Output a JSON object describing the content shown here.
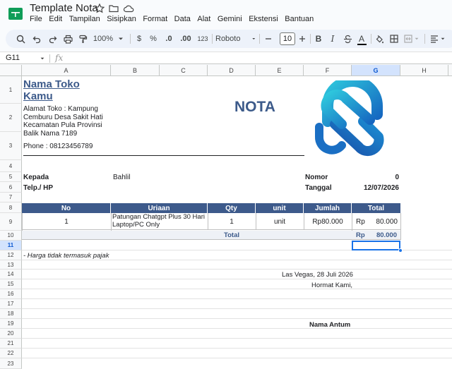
{
  "app": {
    "doc_title": "Template Nota",
    "menus": [
      "File",
      "Edit",
      "Tampilan",
      "Sisipkan",
      "Format",
      "Data",
      "Alat",
      "Gemini",
      "Ekstensi",
      "Bantuan"
    ]
  },
  "toolbar": {
    "zoom": "100%",
    "currency": "$",
    "percent": "%",
    "dec_decrease": ".0",
    "dec_increase": ".00",
    "number_format": "123",
    "font": "Roboto",
    "font_size": "10",
    "bold": "B",
    "italic": "I",
    "text_color_label": "A"
  },
  "formula_bar": {
    "cell_ref": "G11",
    "fx": "fx"
  },
  "columns": [
    "A",
    "B",
    "C",
    "D",
    "E",
    "F",
    "G",
    "H"
  ],
  "rows": [
    "1",
    "2",
    "3",
    "4",
    "5",
    "6",
    "7",
    "8",
    "9",
    "10",
    "11",
    "12",
    "13",
    "14",
    "15",
    "16",
    "17",
    "18",
    "19",
    "20",
    "21",
    "22",
    "23"
  ],
  "selected": {
    "col": "G",
    "row": "11"
  },
  "invoice": {
    "store_name_1": "Nama Toko",
    "store_name_2": "Kamu",
    "address_lines": [
      "Alamat Toko : Kampung",
      "Cemburu Desa Sakit Hati",
      "Kecamatan Pula Provinsi",
      "Balik Nama 7189"
    ],
    "phone": "Phone : 08123456789",
    "heading": "NOTA",
    "to_label": "Kepada",
    "to_value": "Bahlil",
    "phone_label": "Telp./ HP",
    "number_label": "Nomor",
    "number_value": "0",
    "date_label": "Tanggal",
    "date_value": "12/07/2026",
    "table_headers": [
      "No",
      "Uriaan",
      "Qty",
      "unit",
      "Jumlah",
      "Total"
    ],
    "item": {
      "no": "1",
      "desc_1": "Patungan Chatgpt Plus 30 Hari",
      "desc_2": "Laptop/PC Only",
      "qty": "1",
      "unit": "unit",
      "amount": "Rp80.000",
      "total_cur": "Rp",
      "total_val": "80.000"
    },
    "total_label": "Total",
    "total_cur": "Rp",
    "total_val": "80.000",
    "note": "- Harga tidak termasuk pajak",
    "place_date": "Las Vegas, 28 Juli  2026",
    "regards": "Hormat Kami,",
    "signer": "Nama Antum"
  },
  "colors": {
    "brand": "#3d5a8b",
    "logo_light": "#1fc0d8",
    "logo_dark": "#1565c0",
    "selection": "#1a73e8"
  }
}
